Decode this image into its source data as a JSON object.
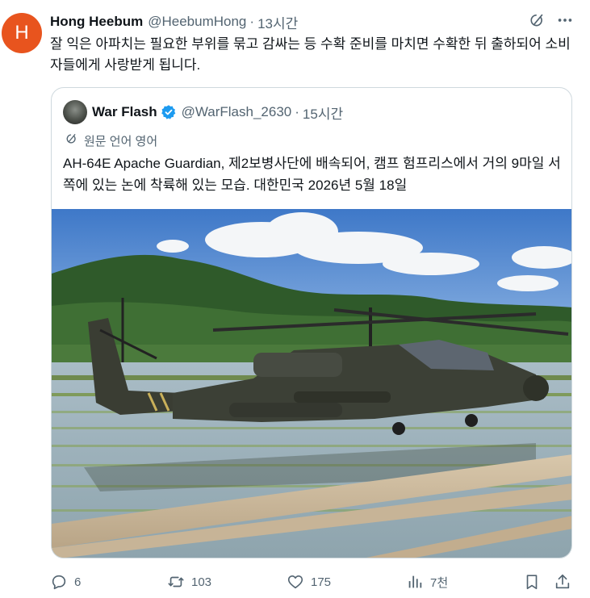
{
  "tweet": {
    "avatar_letter": "H",
    "author_name": "Hong Heebum",
    "author_handle": "@HeebumHong",
    "separator": "·",
    "time": "13시간",
    "text": "잘 익은 아파치는 필요한 부위를 묶고 감싸는 등 수확 준비를 마치면 수확한 뒤 출하되어 소비자들에게 사랑받게 됩니다."
  },
  "quoted": {
    "author_name": "War Flash",
    "author_handle": "@WarFlash_2630",
    "separator": "·",
    "time": "15시간",
    "translate_label": "원문 언어 영어",
    "text": "AH-64E Apache Guardian, 제2보병사단에 배속되어, 캠프 험프리스에서 거의 9마일 서쪽에 있는 논에 착륙해 있는 모습. 대한민국 2026년 5월 18일"
  },
  "actions": {
    "replies": "6",
    "reposts": "103",
    "likes": "175",
    "views": "7천"
  },
  "colors": {
    "accent_blue": "#1d9bf0",
    "muted_text": "#536471",
    "avatar_bg": "#e8541e",
    "border": "#cfd9de"
  },
  "icons": [
    "grok-icon",
    "more-icon",
    "verified-badge-icon",
    "translate-icon",
    "reply-icon",
    "repost-icon",
    "like-icon",
    "views-icon",
    "bookmark-icon",
    "share-icon"
  ]
}
